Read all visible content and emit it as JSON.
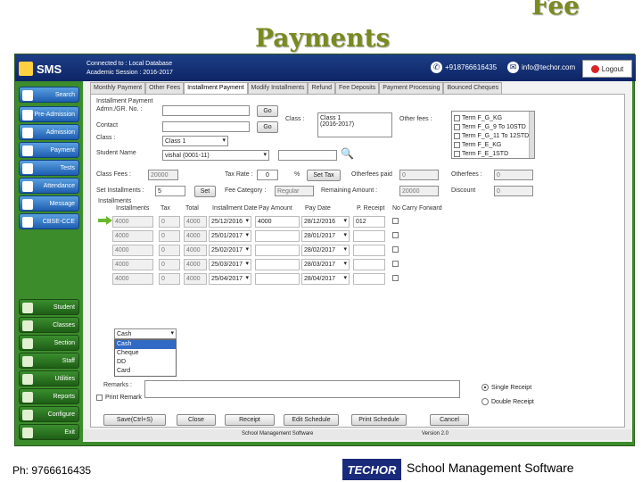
{
  "slide": {
    "title_line1": "Payments",
    "title_line2": "Fee",
    "footer_phone": "Ph: 9766616435",
    "footer_brand": "School Management Software",
    "footer_logo": "TECHOR"
  },
  "header": {
    "app_name": "SMS",
    "connected": "Connected to : Local Database",
    "session": "Academic Session : 2016-2017",
    "phone": "+918766616435",
    "email": "info@techor.com",
    "logout": "Logout"
  },
  "sidebar": {
    "top_items": [
      "Search",
      "Pre-Admission",
      "Admission",
      "Payment",
      "Tests",
      "Attendance",
      "Message",
      "CBSE-CCE"
    ],
    "bottom_items": [
      "Student",
      "Classes",
      "Section",
      "Staff",
      "Utilities",
      "Reports",
      "Configure",
      "Exit"
    ]
  },
  "tabs": [
    "Monthly Payment",
    "Other Fees",
    "Installment Payment",
    "Modify Installments",
    "Refund",
    "Fee Deposits",
    "Payment Processing",
    "Bounced Cheques"
  ],
  "form": {
    "section_title": "Installment Payment",
    "admn_label": "Admn./GR. No. :",
    "go1": "Go",
    "contact_label": "Contact",
    "go2": "Go",
    "class_label": "Class :",
    "class_select": "Class 1",
    "class_box_label": "Class :",
    "class_box_value1": "Class 1",
    "class_box_value2": "(2016-2017)",
    "otherfees_label": "Other fees :",
    "otherfees_items": [
      "Term F_G_KG",
      "Term F_G_9 To 10STD",
      "Term F_G_11 To 12STD",
      "Term F_E_KG",
      "Term F_E_1STD"
    ],
    "student_label": "Student Name",
    "student_value": "vishal  (0001-11)",
    "classfees_label": "Class Fees :",
    "classfees_value": "20000",
    "taxrate_label": "Tax Rate :",
    "taxrate_value": "0",
    "percent": "%",
    "settax": "Set Tax",
    "otherfees_paid_label": "Otherfees paid",
    "otherfees_paid_value": "0",
    "otherfees2_label": "Otherfees :",
    "otherfees2_value": "0",
    "setinst_label": "Set Installments :",
    "setinst_value": "5",
    "set_btn": "Set",
    "feecat_label": "Fee Category :",
    "feecat_value": "Regular",
    "remaining_label": "Remaining Amount :",
    "remaining_value": "20000",
    "discount_label": "Discount",
    "discount_value": "0",
    "installments_group": "Installments",
    "grid_headers": [
      "Installments",
      "Tax",
      "Total",
      "Installment Date",
      "Pay Amount",
      "Pay Date",
      "P. Receipt",
      "No Carry Forward"
    ],
    "rows": [
      {
        "inst": "4000",
        "tax": "0",
        "total": "4000",
        "idate": "25/12/2016",
        "pay": "4000",
        "pdate": "28/12/2016",
        "receipt": "012"
      },
      {
        "inst": "4000",
        "tax": "0",
        "total": "4000",
        "idate": "25/01/2017",
        "pay": "",
        "pdate": "28/01/2017",
        "receipt": ""
      },
      {
        "inst": "4000",
        "tax": "0",
        "total": "4000",
        "idate": "25/02/2017",
        "pay": "",
        "pdate": "28/02/2017",
        "receipt": ""
      },
      {
        "inst": "4000",
        "tax": "0",
        "total": "4000",
        "idate": "25/03/2017",
        "pay": "",
        "pdate": "28/03/2017",
        "receipt": ""
      },
      {
        "inst": "4000",
        "tax": "0",
        "total": "4000",
        "idate": "25/04/2017",
        "pay": "",
        "pdate": "28/04/2017",
        "receipt": ""
      }
    ],
    "paymode_selected": "Cash",
    "paymode_options": [
      "Cash",
      "Cheque",
      "DD",
      "Card"
    ],
    "remarks_label": "Remarks :",
    "print_remark": "Print Remark",
    "single_receipt": "Single Receipt",
    "double_receipt": "Double Receipt",
    "buttons": [
      "Save(Ctrl+S)",
      "Close",
      "Receipt",
      "Edit Schedule",
      "Print Schedule",
      "Cancel"
    ]
  },
  "statusbar": {
    "app": "School Management Software",
    "version": "Version 2.0"
  },
  "colors": {
    "title": "#7a8a20",
    "header_blue": "#0d2566",
    "sidebar_green": "#3c8c2c"
  }
}
